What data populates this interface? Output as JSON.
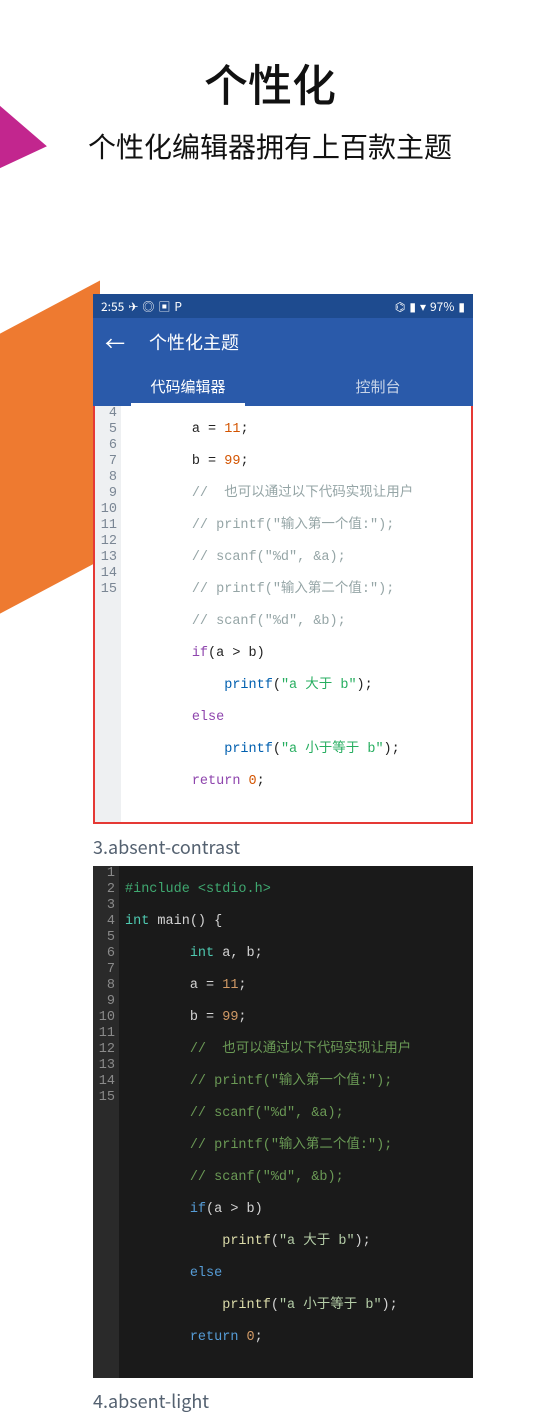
{
  "hero": {
    "title": "个性化",
    "subtitle": "个性化编辑器拥有上百款主题"
  },
  "statusbar": {
    "time": "2:55",
    "battery": "97%"
  },
  "appbar": {
    "title": "个性化主题"
  },
  "tabs": {
    "editor": "代码编辑器",
    "console": "控制台"
  },
  "theme_labels": {
    "three": "3.absent-contrast",
    "four": "4.absent-light"
  },
  "light": {
    "lines": [
      "4",
      "5",
      "6",
      "7",
      "8",
      "9",
      "10",
      "11",
      "12",
      "13",
      "14",
      "15"
    ],
    "l4": {
      "v": "a",
      "eq": "=",
      "n": "11",
      "s": ";"
    },
    "l5": {
      "v": "b",
      "eq": "=",
      "n": "99",
      "s": ";"
    },
    "c1": "//  也可以通过以下代码实现让用户",
    "c2": "// printf(\"输入第一个值:\");",
    "c3": "// scanf(\"%d\", &a);",
    "c4": "// printf(\"输入第二个值:\");",
    "c5": "// scanf(\"%d\", &b);",
    "if": "if",
    "cond": "(a > b)",
    "p1a": "printf",
    "p1b": "(",
    "p1s": "\"a 大于 b\"",
    "p1c": ");",
    "else": "else",
    "p2a": "printf",
    "p2b": "(",
    "p2s": "\"a 小于等于 b\"",
    "p2c": ");",
    "ret": "return ",
    "zero": "0",
    "retS": ";"
  },
  "dark": {
    "lines": [
      "1",
      "2",
      "3",
      "4",
      "5",
      "6",
      "7",
      "8",
      "9",
      "10",
      "11",
      "12",
      "13",
      "14",
      "15"
    ],
    "inc": "#include <stdio.h>",
    "ty": "int",
    "main": " main() {",
    "dint": "int",
    "decl": " a, b;",
    "l4a": "a = ",
    "l4n": "11",
    "l4s": ";",
    "l5a": "b = ",
    "l5n": "99",
    "l5s": ";",
    "c1": "//  也可以通过以下代码实现让用户",
    "c2": "// printf(\"输入第一个值:\");",
    "c3": "// scanf(\"%d\", &a);",
    "c4": "// printf(\"输入第二个值:\");",
    "c5": "// scanf(\"%d\", &b);",
    "if": "if",
    "cond": "(a > b)",
    "p1a": "printf",
    "p1b": "(",
    "p1s": "\"a 大于 b\"",
    "p1c": ");",
    "else": "else",
    "p2a": "printf",
    "p2b": "(",
    "p2s": "\"a 小于等于 b\"",
    "p2c": ");",
    "ret": "return ",
    "zero": "0",
    "retS": ";"
  }
}
